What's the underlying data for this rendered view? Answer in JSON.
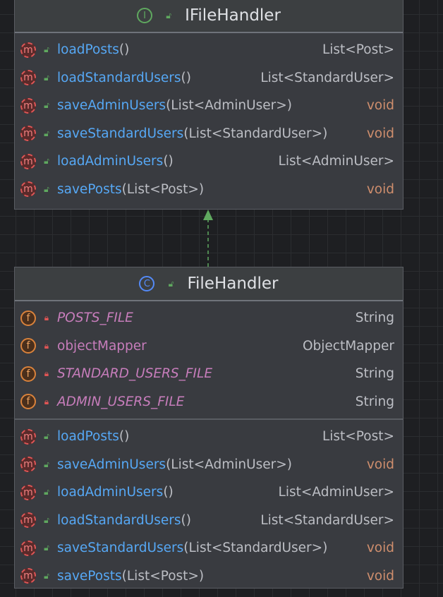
{
  "interface": {
    "title": "IFileHandler",
    "icon": "interface-icon",
    "methods": [
      {
        "name": "loadPosts",
        "params": "()",
        "type": "List<Post>"
      },
      {
        "name": "loadStandardUsers",
        "params": "()",
        "type": "List<StandardUser>"
      },
      {
        "name": "saveAdminUsers",
        "params": "(List<AdminUser>)",
        "type": "void"
      },
      {
        "name": "saveStandardUsers",
        "params": "(List<StandardUser>)",
        "type": "void"
      },
      {
        "name": "loadAdminUsers",
        "params": "()",
        "type": "List<AdminUser>"
      },
      {
        "name": "savePosts",
        "params": "(List<Post>)",
        "type": "void"
      }
    ]
  },
  "class": {
    "title": "FileHandler",
    "icon": "class-icon",
    "fields": [
      {
        "name": "POSTS_FILE",
        "type": "String",
        "static": true
      },
      {
        "name": "objectMapper",
        "type": "ObjectMapper",
        "static": false
      },
      {
        "name": "STANDARD_USERS_FILE",
        "type": "String",
        "static": true
      },
      {
        "name": "ADMIN_USERS_FILE",
        "type": "String",
        "static": true
      }
    ],
    "methods": [
      {
        "name": "loadPosts",
        "params": "()",
        "type": "List<Post>"
      },
      {
        "name": "saveAdminUsers",
        "params": "(List<AdminUser>)",
        "type": "void"
      },
      {
        "name": "loadAdminUsers",
        "params": "()",
        "type": "List<AdminUser>"
      },
      {
        "name": "loadStandardUsers",
        "params": "()",
        "type": "List<StandardUser>"
      },
      {
        "name": "saveStandardUsers",
        "params": "(List<StandardUser>)",
        "type": "void"
      },
      {
        "name": "savePosts",
        "params": "(List<Post>)",
        "type": "void"
      }
    ]
  },
  "colors": {
    "method": "#56a8f5",
    "field": "#c77dbb",
    "void": "#cf8e6d",
    "arrow": "#5fa85f"
  }
}
